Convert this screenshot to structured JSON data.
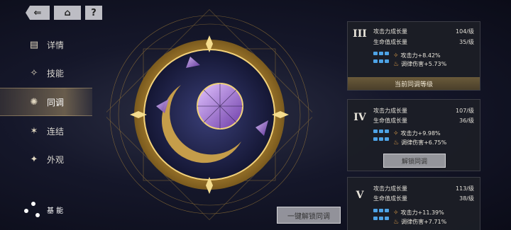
{
  "topbar": {
    "back_icon": "back-arrow-icon",
    "home_icon": "home-icon",
    "help_label": "?"
  },
  "sidebar": {
    "items": [
      {
        "label": "详情",
        "icon": "document-icon"
      },
      {
        "label": "技能",
        "icon": "skill-icon"
      },
      {
        "label": "同调",
        "icon": "sync-icon",
        "active": true
      },
      {
        "label": "连结",
        "icon": "link-star-icon"
      },
      {
        "label": "外观",
        "icon": "appearance-icon"
      }
    ]
  },
  "basic": {
    "label": "基 能"
  },
  "unlock_all_label": "一键解锁同调",
  "cards": [
    {
      "numeral": "III",
      "stats": [
        {
          "label": "攻击力成长量",
          "value": "104/级"
        },
        {
          "label": "生命值成长量",
          "value": "35/级"
        }
      ],
      "bonuses": [
        "攻击力+8.42%",
        "调律伤害+5.73%"
      ],
      "footer": "当前同调等级"
    },
    {
      "numeral": "IV",
      "stats": [
        {
          "label": "攻击力成长量",
          "value": "107/级"
        },
        {
          "label": "生命值成长量",
          "value": "36/级"
        }
      ],
      "bonuses": [
        "攻击力+9.98%",
        "调律伤害+6.75%"
      ],
      "button": "解锁同调"
    },
    {
      "numeral": "V",
      "stats": [
        {
          "label": "攻击力成长量",
          "value": "113/级"
        },
        {
          "label": "生命值成长量",
          "value": "38/级"
        }
      ],
      "bonuses": [
        "攻击力+11.39%",
        "调律伤害+7.71%"
      ]
    }
  ],
  "colors": {
    "gold": "#d9b15a",
    "accent_blue": "#4ea3e6",
    "bonus_orange": "#e2a04a"
  }
}
